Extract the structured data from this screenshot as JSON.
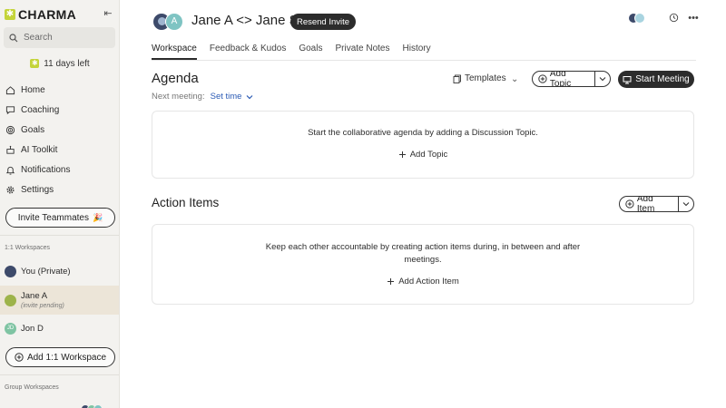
{
  "sidebar": {
    "logo_text": "CHARMA",
    "search_placeholder": "Search",
    "trial_text": "11 days left",
    "nav": [
      {
        "label": "Home",
        "icon": "home-icon"
      },
      {
        "label": "Coaching",
        "icon": "coaching-icon"
      },
      {
        "label": "Goals",
        "icon": "target-icon"
      },
      {
        "label": "AI Toolkit",
        "icon": "ai-toolkit-icon"
      },
      {
        "label": "Notifications",
        "icon": "bell-icon"
      },
      {
        "label": "Settings",
        "icon": "gear-icon"
      }
    ],
    "invite_label": "Invite Teammates",
    "one_on_one_label": "1:1 Workspaces",
    "workspaces": [
      {
        "name": "You (Private)"
      },
      {
        "name": "Jane A",
        "sub": "(invite pending)"
      },
      {
        "name": "Jon D",
        "initials": "JD"
      }
    ],
    "add_workspace_label": "Add 1:1 Workspace",
    "group_label": "Group Workspaces"
  },
  "header": {
    "avatar_initial": "A",
    "title": "Jane A <> Jane S",
    "resend_label": "Resend Invite"
  },
  "tabs": [
    "Workspace",
    "Feedback & Kudos",
    "Goals",
    "Private Notes",
    "History"
  ],
  "agenda": {
    "title": "Agenda",
    "next_meeting_label": "Next meeting:",
    "set_time_label": "Set time",
    "templates_label": "Templates",
    "add_topic_label": "Add Topic",
    "start_meeting_label": "Start Meeting",
    "empty_message": "Start the collaborative agenda by adding a Discussion Topic.",
    "empty_action": "Add Topic"
  },
  "action_items": {
    "title": "Action Items",
    "add_item_label": "Add Item",
    "empty_message_line1": "Keep each other accountable by creating action items during, in between and after",
    "empty_message_line2": "meetings.",
    "empty_action": "Add Action Item"
  },
  "colors": {
    "brand": "#c4d43a",
    "dark_button": "#2c2c2c",
    "link": "#2b5bb5",
    "sidebar_bg": "#f3f2ef",
    "active_workspace_bg": "#ece5d8"
  }
}
